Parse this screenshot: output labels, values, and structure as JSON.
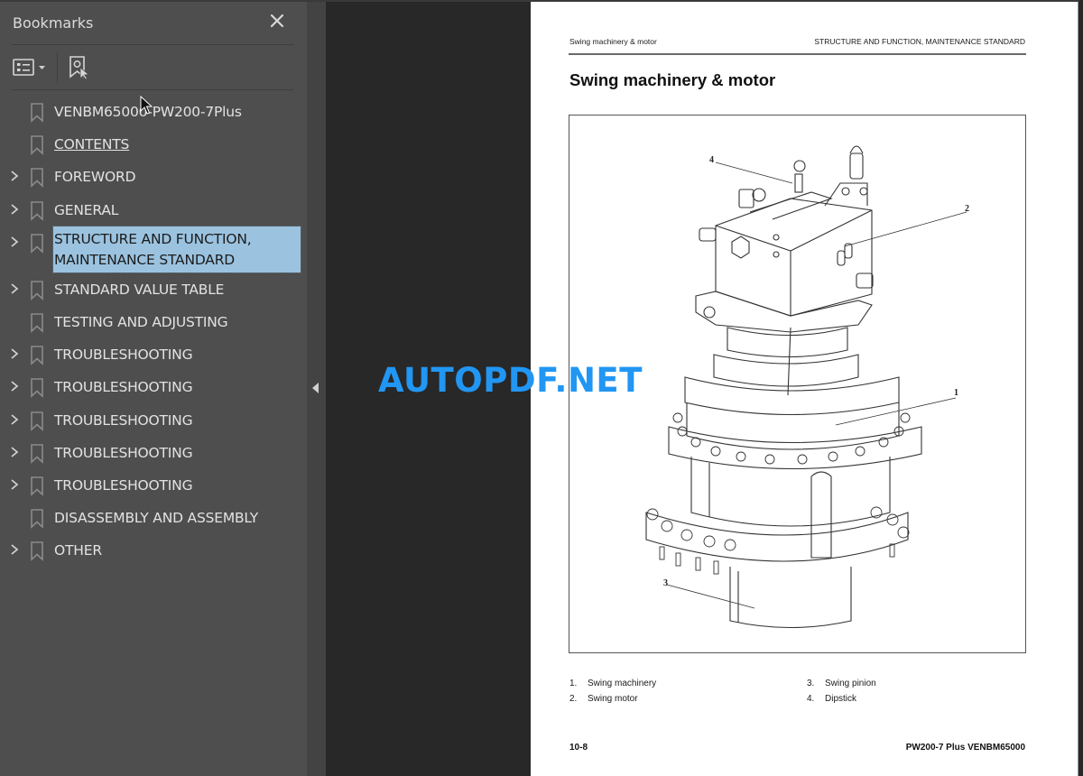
{
  "sidebar": {
    "title": "Bookmarks",
    "close_icon": "close-icon",
    "options_icon": "list-options-icon",
    "find_bookmark_icon": "find-current-bookmark-icon",
    "items": [
      {
        "label": "VENBM65000-PW200-7Plus",
        "expandable": false,
        "selected": false,
        "link": false
      },
      {
        "label": "CONTENTS",
        "expandable": false,
        "selected": false,
        "link": true
      },
      {
        "label": "FOREWORD",
        "expandable": true,
        "selected": false,
        "link": false
      },
      {
        "label": "GENERAL",
        "expandable": true,
        "selected": false,
        "link": false
      },
      {
        "label": "STRUCTURE AND FUNCTION, MAINTENANCE STANDARD",
        "expandable": true,
        "selected": true,
        "link": false
      },
      {
        "label": "STANDARD VALUE TABLE",
        "expandable": true,
        "selected": false,
        "link": false
      },
      {
        "label": "TESTING AND ADJUSTING",
        "expandable": false,
        "selected": false,
        "link": false
      },
      {
        "label": "TROUBLESHOOTING",
        "expandable": true,
        "selected": false,
        "link": false
      },
      {
        "label": "TROUBLESHOOTING",
        "expandable": true,
        "selected": false,
        "link": false
      },
      {
        "label": "TROUBLESHOOTING",
        "expandable": true,
        "selected": false,
        "link": false
      },
      {
        "label": "TROUBLESHOOTING",
        "expandable": true,
        "selected": false,
        "link": false
      },
      {
        "label": "TROUBLESHOOTING",
        "expandable": true,
        "selected": false,
        "link": false
      },
      {
        "label": "DISASSEMBLY AND ASSEMBLY",
        "expandable": false,
        "selected": false,
        "link": false
      },
      {
        "label": "OTHER",
        "expandable": true,
        "selected": false,
        "link": false
      }
    ]
  },
  "page": {
    "header_left": "Swing machinery & motor",
    "header_right": "STRUCTURE AND FUNCTION, MAINTENANCE STANDARD",
    "title": "Swing machinery & motor",
    "callouts": [
      "1",
      "2",
      "3",
      "4"
    ],
    "captions": [
      {
        "num": "1.",
        "text": "Swing machinery"
      },
      {
        "num": "2.",
        "text": "Swing motor"
      },
      {
        "num": "3.",
        "text": "Swing pinion"
      },
      {
        "num": "4.",
        "text": "Dipstick"
      }
    ],
    "footer_left": "10-8",
    "footer_right": "PW200-7 Plus  VENBM65000"
  },
  "watermark": "AUTOPDF.NET",
  "colors": {
    "sidebar_bg": "#4e4e4e",
    "selection_bg": "#9bc3e0",
    "doc_bg": "#282828",
    "watermark": "#2196f3"
  }
}
